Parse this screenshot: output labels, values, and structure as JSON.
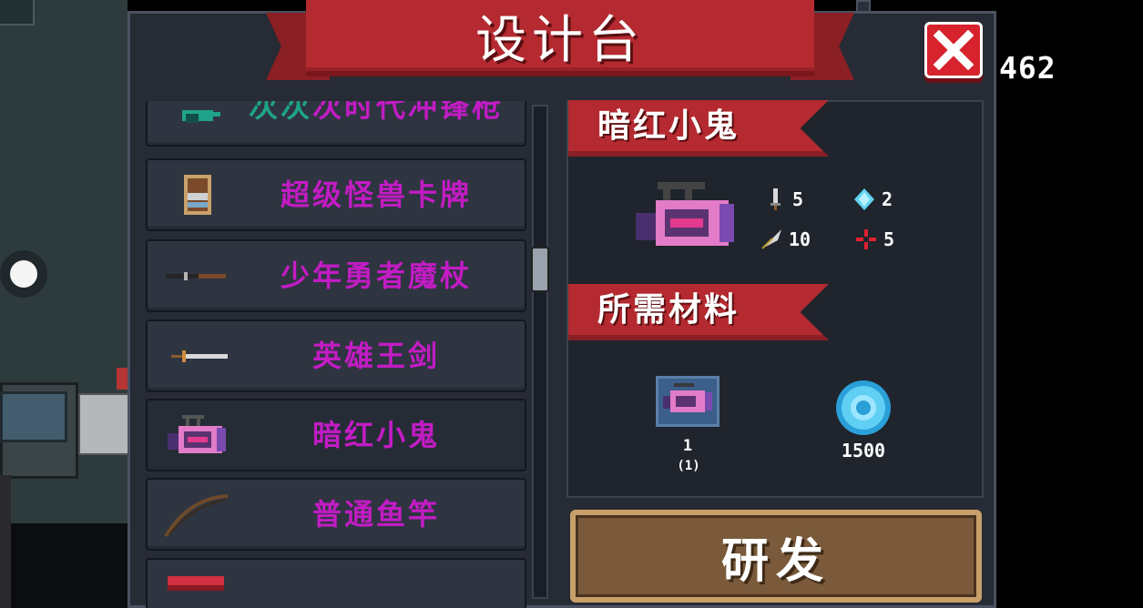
{
  "hud": {
    "gem_count": "462"
  },
  "dialog": {
    "title": "设计台",
    "close_icon": "close-x-icon",
    "accent": "#b42a30",
    "item_name_color": "#c21cc4"
  },
  "list": {
    "items": [
      {
        "name_prefix": "次次",
        "name": "次时代冲锋枪",
        "icon": "smg-icon"
      },
      {
        "name": "超级怪兽卡牌",
        "icon": "card-icon"
      },
      {
        "name": "少年勇者魔杖",
        "icon": "wand-icon"
      },
      {
        "name": "英雄王剑",
        "icon": "sword-icon"
      },
      {
        "name": "暗红小鬼",
        "icon": "camera-gun-icon",
        "selected": true
      },
      {
        "name": "普通鱼竿",
        "icon": "fishing-rod-icon"
      },
      {
        "name": "",
        "icon": "red-weapon-icon"
      }
    ]
  },
  "detail": {
    "weapon_name": "暗红小鬼",
    "stats": {
      "attack": "5",
      "energy": "2",
      "crit": "10",
      "precision": "5"
    },
    "materials_heading": "所需材料",
    "materials": {
      "blueprint_count": "1",
      "blueprint_owned": "(1)",
      "gems": "1500"
    }
  },
  "actions": {
    "craft_label": "研发"
  }
}
